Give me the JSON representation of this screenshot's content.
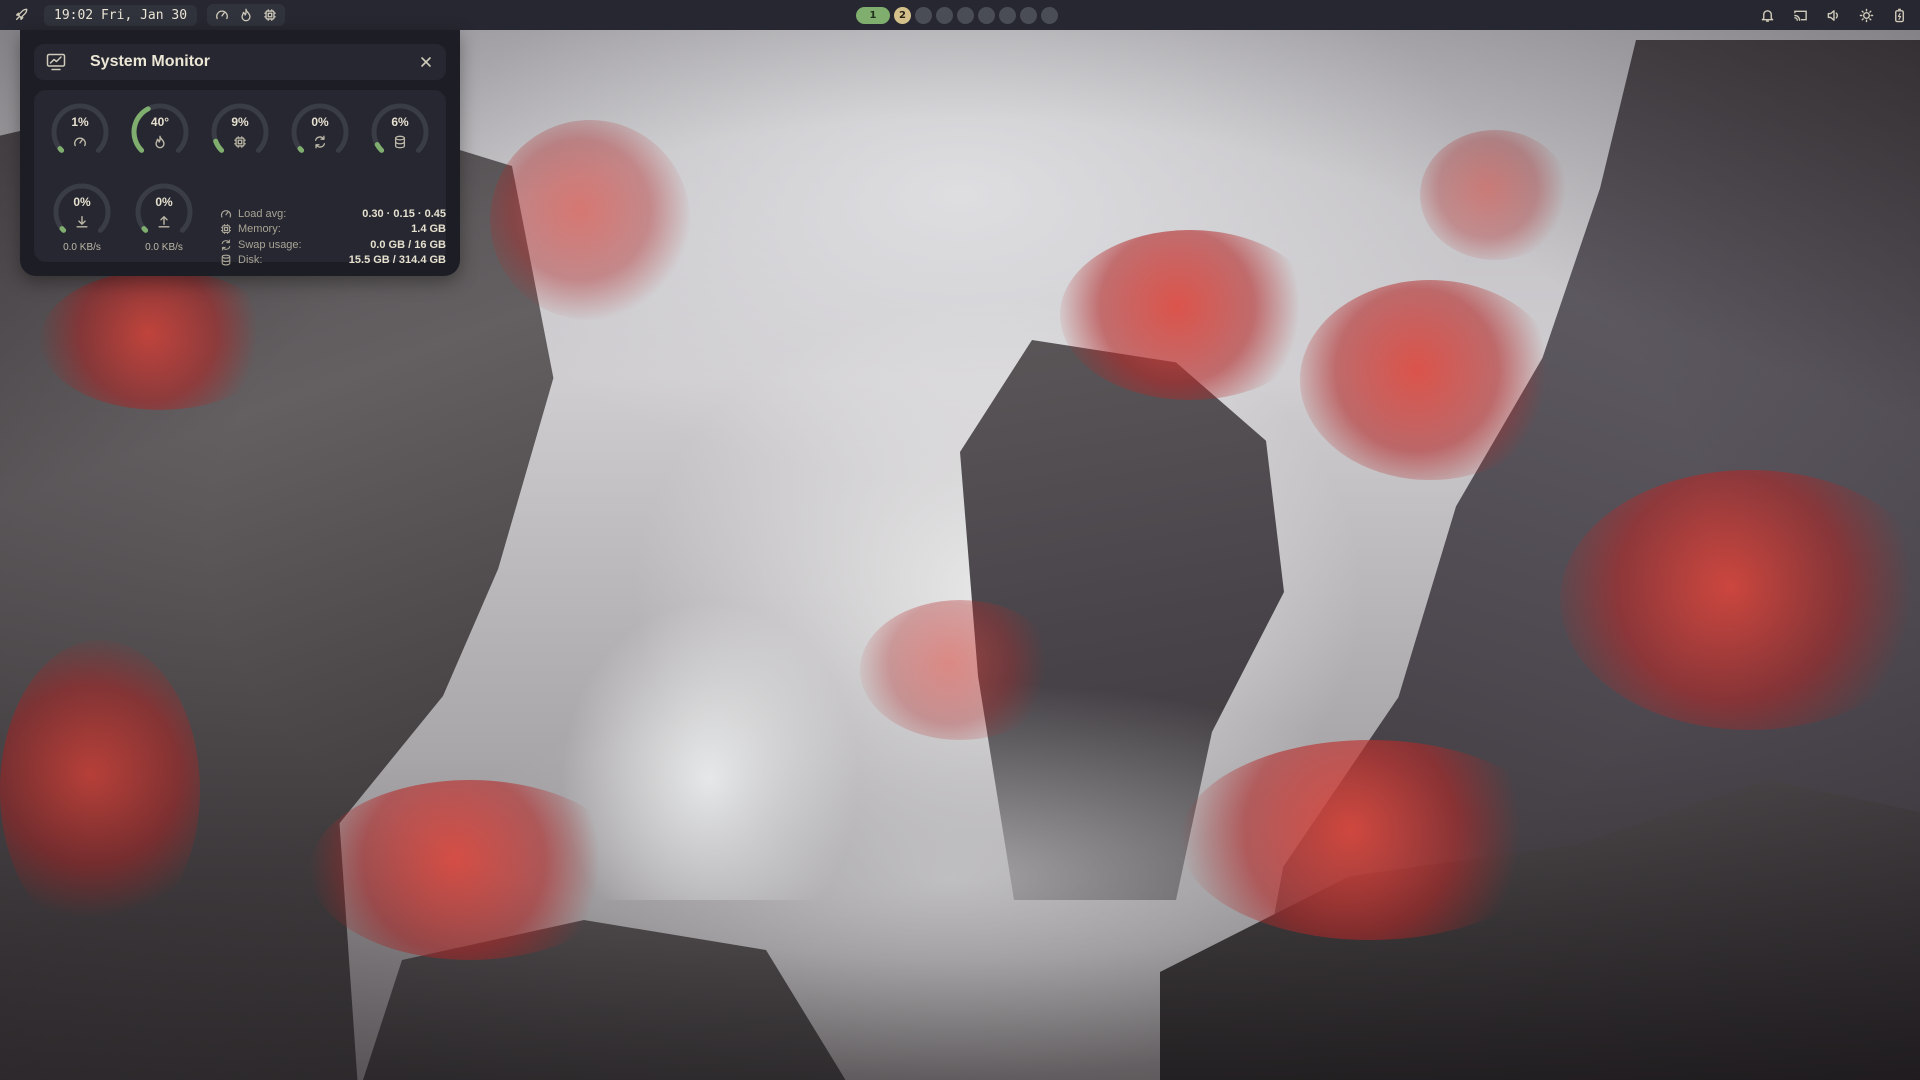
{
  "topbar": {
    "launcher_icon": "rocket-icon",
    "clock": "19:02 Fri, Jan 30",
    "stat_icons": [
      "gauge-icon",
      "flame-icon",
      "memory-chip-icon"
    ],
    "workspaces": [
      {
        "label": "1",
        "state": "active"
      },
      {
        "label": "2",
        "state": "occupied"
      },
      {
        "label": "",
        "state": "empty"
      },
      {
        "label": "",
        "state": "empty"
      },
      {
        "label": "",
        "state": "empty"
      },
      {
        "label": "",
        "state": "empty"
      },
      {
        "label": "",
        "state": "empty"
      },
      {
        "label": "",
        "state": "empty"
      },
      {
        "label": "",
        "state": "empty"
      }
    ],
    "tray_icons": [
      "bell-icon",
      "cast-icon",
      "volume-icon",
      "brightness-icon",
      "battery-icon"
    ]
  },
  "sysmon": {
    "title": "System Monitor",
    "title_icon": "monitor-chart-icon",
    "close_icon": "close-icon",
    "gauges": [
      {
        "id": "cpu",
        "value": "1%",
        "fraction": 0.01,
        "icon": "gauge-icon"
      },
      {
        "id": "temp",
        "value": "40°",
        "fraction": 0.4,
        "icon": "flame-icon"
      },
      {
        "id": "memory",
        "value": "9%",
        "fraction": 0.09,
        "icon": "memory-chip-icon"
      },
      {
        "id": "swap",
        "value": "0%",
        "fraction": 0.0,
        "icon": "swap-arrows-icon"
      },
      {
        "id": "disk",
        "value": "6%",
        "fraction": 0.06,
        "icon": "database-icon"
      }
    ],
    "network": [
      {
        "id": "download",
        "value": "0%",
        "fraction": 0.0,
        "icon": "download-icon",
        "rate": "0.0 KB/s"
      },
      {
        "id": "upload",
        "value": "0%",
        "fraction": 0.0,
        "icon": "upload-icon",
        "rate": "0.0 KB/s"
      }
    ],
    "stats": [
      {
        "icon": "gauge-icon",
        "label": "Load avg:",
        "value": "0.30 · 0.15 · 0.45"
      },
      {
        "icon": "memory-chip-icon",
        "label": "Memory:",
        "value": "1.4 GB"
      },
      {
        "icon": "swap-arrows-icon",
        "label": "Swap usage:",
        "value": "0.0 GB / 16 GB"
      },
      {
        "icon": "database-icon",
        "label": "Disk:",
        "value": "15.5 GB / 314.4 GB"
      }
    ]
  },
  "colors": {
    "accent_green": "#7fae6e",
    "workspace_occupied": "#d4c08a",
    "panel_bg": "#1d1e25",
    "card_bg": "#262730",
    "track": "#3a3c46"
  }
}
